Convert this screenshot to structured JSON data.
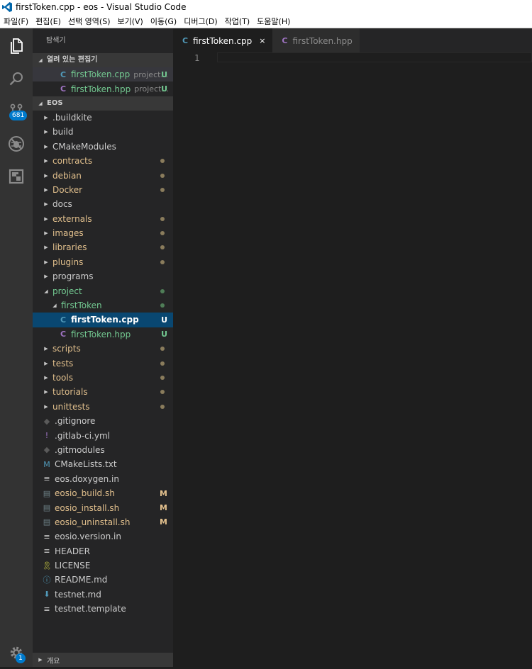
{
  "titlebar": {
    "title": "firstToken.cpp - eos - Visual Studio Code"
  },
  "menu": [
    "파일(F)",
    "편집(E)",
    "선택 영역(S)",
    "보기(V)",
    "이동(G)",
    "디버그(D)",
    "작업(T)",
    "도움말(H)"
  ],
  "activity": {
    "scm_badge": "681",
    "settings_badge": "1"
  },
  "sidebar": {
    "title": "탐색기",
    "open_editors_header": "열려 있는 편집기",
    "open_editors": [
      {
        "name": "firstToken.cpp",
        "desc": "project...",
        "status": "U",
        "icon_color": "#519aba",
        "selected": true
      },
      {
        "name": "firstToken.hpp",
        "desc": "project...",
        "status": "U",
        "icon_color": "#a074c4",
        "selected": false
      }
    ],
    "workspace_header": "EOS",
    "tree": [
      {
        "name": ".buildkite",
        "type": "folder",
        "depth": 0,
        "expanded": false,
        "color": "#cccccc"
      },
      {
        "name": "build",
        "type": "folder",
        "depth": 0,
        "expanded": false,
        "color": "#cccccc"
      },
      {
        "name": "CMakeModules",
        "type": "folder",
        "depth": 0,
        "expanded": false,
        "color": "#cccccc"
      },
      {
        "name": "contracts",
        "type": "folder",
        "depth": 0,
        "expanded": false,
        "color": "#e2c08d",
        "dot": "#8a7c5c"
      },
      {
        "name": "debian",
        "type": "folder",
        "depth": 0,
        "expanded": false,
        "color": "#e2c08d",
        "dot": "#8a7c5c"
      },
      {
        "name": "Docker",
        "type": "folder",
        "depth": 0,
        "expanded": false,
        "color": "#e2c08d",
        "dot": "#8a7c5c"
      },
      {
        "name": "docs",
        "type": "folder",
        "depth": 0,
        "expanded": false,
        "color": "#cccccc"
      },
      {
        "name": "externals",
        "type": "folder",
        "depth": 0,
        "expanded": false,
        "color": "#e2c08d",
        "dot": "#8a7c5c"
      },
      {
        "name": "images",
        "type": "folder",
        "depth": 0,
        "expanded": false,
        "color": "#e2c08d",
        "dot": "#8a7c5c"
      },
      {
        "name": "libraries",
        "type": "folder",
        "depth": 0,
        "expanded": false,
        "color": "#e2c08d",
        "dot": "#8a7c5c"
      },
      {
        "name": "plugins",
        "type": "folder",
        "depth": 0,
        "expanded": false,
        "color": "#e2c08d",
        "dot": "#8a7c5c"
      },
      {
        "name": "programs",
        "type": "folder",
        "depth": 0,
        "expanded": false,
        "color": "#cccccc"
      },
      {
        "name": "project",
        "type": "folder",
        "depth": 0,
        "expanded": true,
        "color": "#73c991",
        "dot": "#4f7d57"
      },
      {
        "name": "firstToken",
        "type": "folder",
        "depth": 1,
        "expanded": true,
        "color": "#73c991",
        "dot": "#4f7d57"
      },
      {
        "name": "firstToken.cpp",
        "type": "file",
        "depth": 2,
        "icon": "C+",
        "icon_color": "#519aba",
        "color": "#ffffff",
        "status": "U",
        "status_color": "#ffffff",
        "selected": true
      },
      {
        "name": "firstToken.hpp",
        "type": "file",
        "depth": 2,
        "icon": "C+",
        "icon_color": "#a074c4",
        "color": "#73c991",
        "status": "U",
        "status_color": "#73c991"
      },
      {
        "name": "scripts",
        "type": "folder",
        "depth": 0,
        "expanded": false,
        "color": "#e2c08d",
        "dot": "#8a7c5c"
      },
      {
        "name": "tests",
        "type": "folder",
        "depth": 0,
        "expanded": false,
        "color": "#e2c08d",
        "dot": "#8a7c5c"
      },
      {
        "name": "tools",
        "type": "folder",
        "depth": 0,
        "expanded": false,
        "color": "#e2c08d",
        "dot": "#8a7c5c"
      },
      {
        "name": "tutorials",
        "type": "folder",
        "depth": 0,
        "expanded": false,
        "color": "#e2c08d",
        "dot": "#8a7c5c"
      },
      {
        "name": "unittests",
        "type": "folder",
        "depth": 0,
        "expanded": false,
        "color": "#e2c08d",
        "dot": "#8a7c5c"
      },
      {
        "name": ".gitignore",
        "type": "file",
        "depth": 0,
        "icon": "◆",
        "icon_color": "#5a5a5a",
        "color": "#cccccc"
      },
      {
        "name": ".gitlab-ci.yml",
        "type": "file",
        "depth": 0,
        "icon": "!",
        "icon_color": "#a074c4",
        "color": "#cccccc"
      },
      {
        "name": ".gitmodules",
        "type": "file",
        "depth": 0,
        "icon": "◆",
        "icon_color": "#5a5a5a",
        "color": "#cccccc"
      },
      {
        "name": "CMakeLists.txt",
        "type": "file",
        "depth": 0,
        "icon": "M",
        "icon_color": "#519aba",
        "color": "#cccccc"
      },
      {
        "name": "eos.doxygen.in",
        "type": "file",
        "depth": 0,
        "icon": "≡",
        "icon_color": "#cccccc",
        "color": "#cccccc"
      },
      {
        "name": "eosio_build.sh",
        "type": "file",
        "depth": 0,
        "icon": "▤",
        "icon_color": "#6d8086",
        "color": "#e2c08d",
        "status": "M",
        "status_color": "#e2c08d"
      },
      {
        "name": "eosio_install.sh",
        "type": "file",
        "depth": 0,
        "icon": "▤",
        "icon_color": "#6d8086",
        "color": "#e2c08d",
        "status": "M",
        "status_color": "#e2c08d"
      },
      {
        "name": "eosio_uninstall.sh",
        "type": "file",
        "depth": 0,
        "icon": "▤",
        "icon_color": "#6d8086",
        "color": "#e2c08d",
        "status": "M",
        "status_color": "#e2c08d"
      },
      {
        "name": "eosio.version.in",
        "type": "file",
        "depth": 0,
        "icon": "≡",
        "icon_color": "#cccccc",
        "color": "#cccccc"
      },
      {
        "name": "HEADER",
        "type": "file",
        "depth": 0,
        "icon": "≡",
        "icon_color": "#cccccc",
        "color": "#cccccc"
      },
      {
        "name": "LICENSE",
        "type": "file",
        "depth": 0,
        "icon": "🎗",
        "icon_color": "#cbcb41",
        "color": "#cccccc"
      },
      {
        "name": "README.md",
        "type": "file",
        "depth": 0,
        "icon": "ⓘ",
        "icon_color": "#519aba",
        "color": "#cccccc"
      },
      {
        "name": "testnet.md",
        "type": "file",
        "depth": 0,
        "icon": "⬇",
        "icon_color": "#519aba",
        "color": "#cccccc"
      },
      {
        "name": "testnet.template",
        "type": "file",
        "depth": 0,
        "icon": "≡",
        "icon_color": "#cccccc",
        "color": "#cccccc"
      }
    ],
    "outline_header": "개요"
  },
  "tabs": [
    {
      "name": "firstToken.cpp",
      "active": true,
      "icon_color": "#519aba",
      "close": "×"
    },
    {
      "name": "firstToken.hpp",
      "active": false,
      "icon_color": "#a074c4"
    }
  ],
  "editor": {
    "line_number": "1"
  }
}
